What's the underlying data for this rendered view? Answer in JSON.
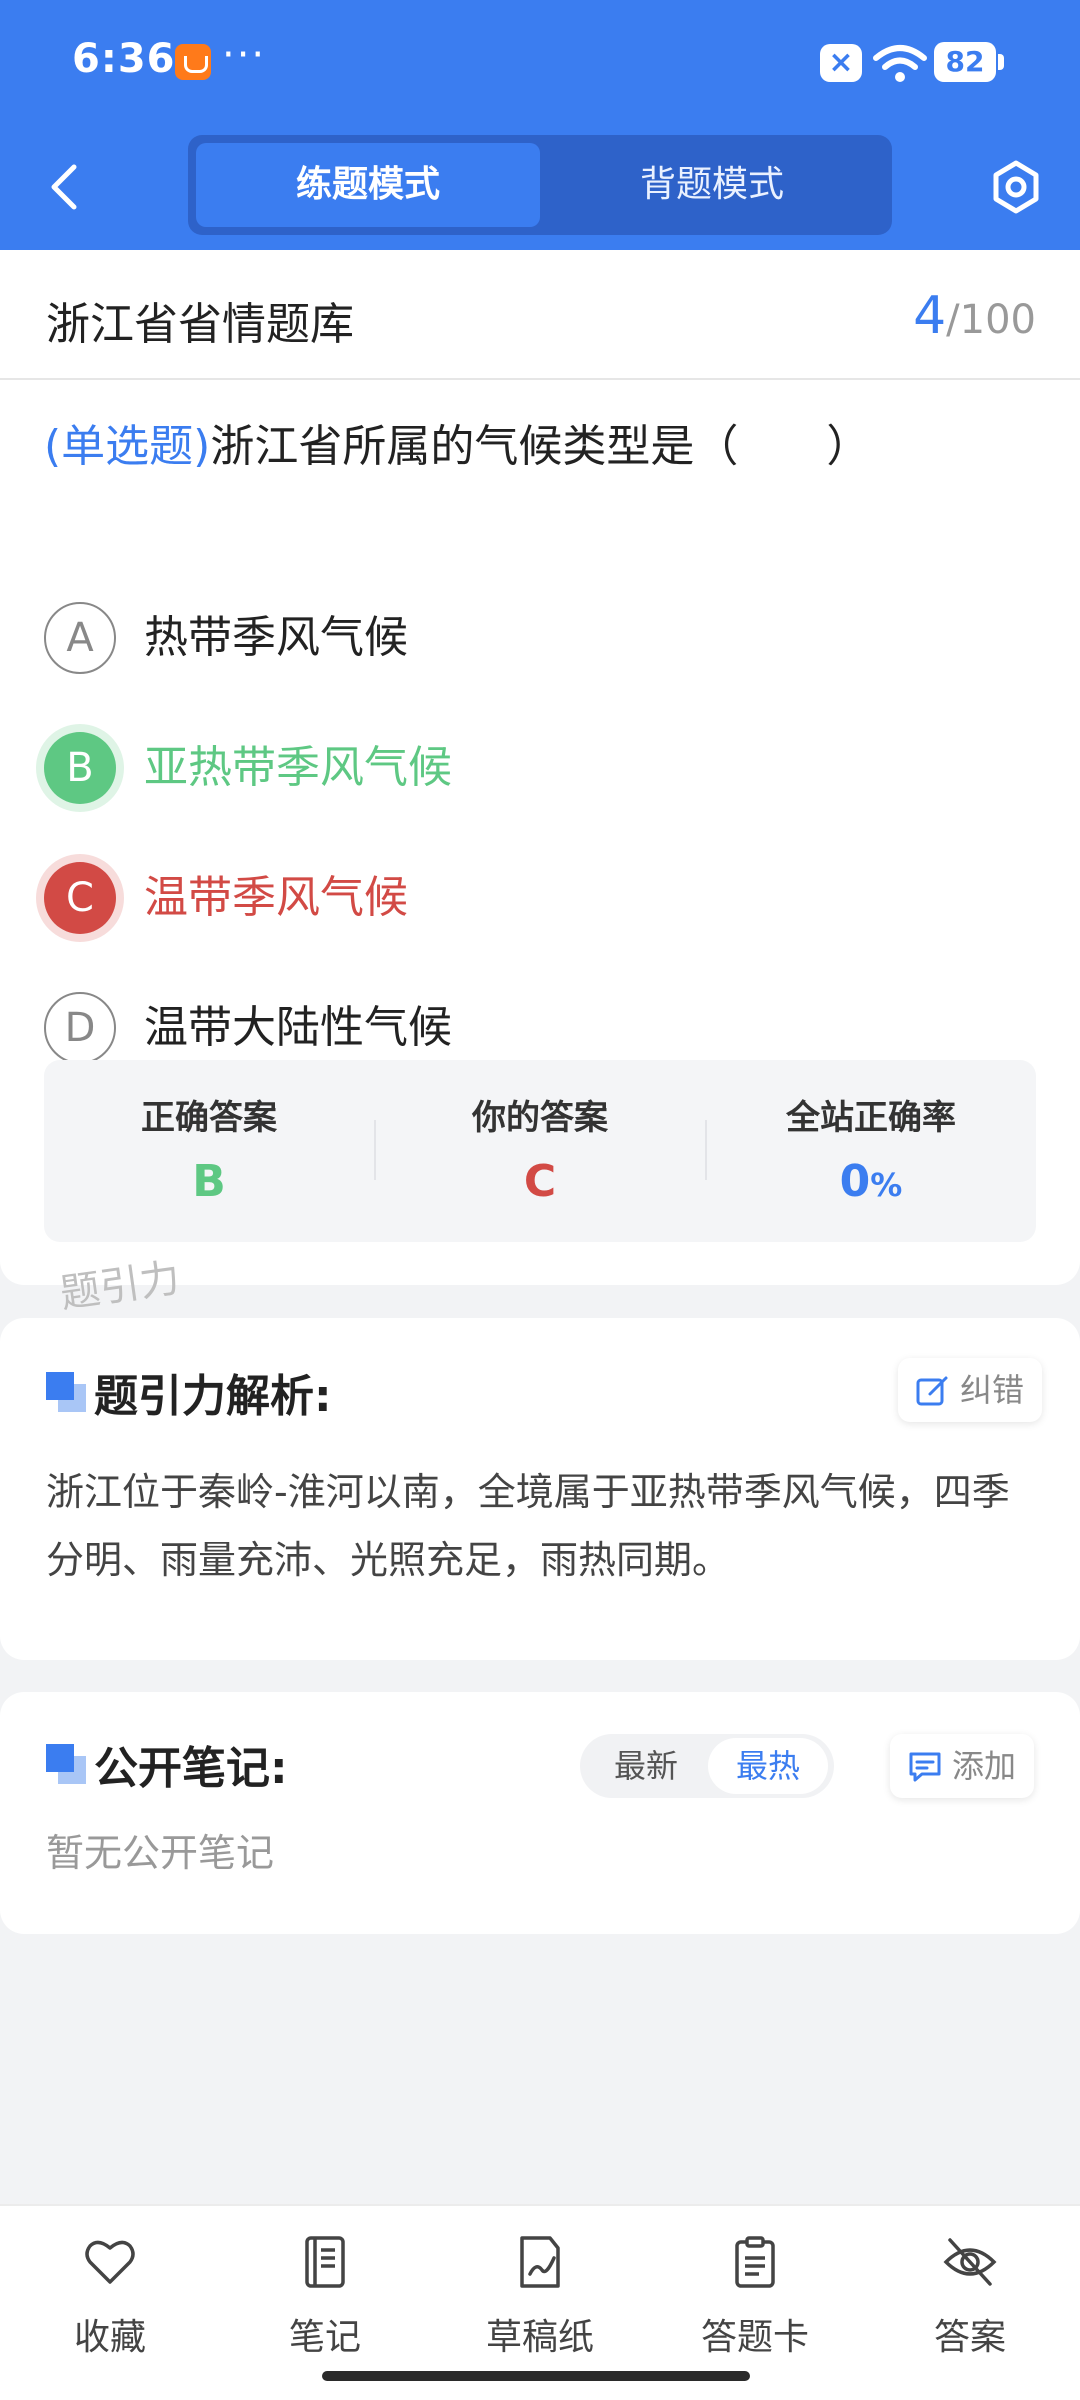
{
  "status_bar": {
    "time": "6:36",
    "dots": "···",
    "battery": "82"
  },
  "nav": {
    "modes": [
      "练题模式",
      "背题模式"
    ],
    "active_mode": "练题模式"
  },
  "question": {
    "bank_title": "浙江省省情题库",
    "progress_current": "4",
    "progress_total": "/100",
    "type_label": "(单选题)",
    "text": "浙江省所属的气候类型是（　　）",
    "options": [
      {
        "letter": "A",
        "text": "热带季风气候",
        "state": "normal"
      },
      {
        "letter": "B",
        "text": "亚热带季风气候",
        "state": "correct"
      },
      {
        "letter": "C",
        "text": "温带季风气候",
        "state": "wrong"
      },
      {
        "letter": "D",
        "text": "温带大陆性气候",
        "state": "normal"
      }
    ]
  },
  "stats": {
    "correct_label": "正确答案",
    "correct_value": "B",
    "yours_label": "你的答案",
    "yours_value": "C",
    "rate_label": "全站正确率",
    "rate_value": "0",
    "rate_unit": "%"
  },
  "watermark": "题引力",
  "analysis": {
    "title": "题引力解析:",
    "report_label": "纠错",
    "text": "浙江位于秦岭-淮河以南，全境属于亚热带季风气候，四季分明、雨量充沛、光照充足，雨热同期。"
  },
  "notes": {
    "title": "公开笔记:",
    "sort_newest": "最新",
    "sort_hottest": "最热",
    "add_label": "添加",
    "empty_text": "暂无公开笔记"
  },
  "toolbar": [
    {
      "label": "收藏",
      "icon": "heart-icon"
    },
    {
      "label": "笔记",
      "icon": "notebook-icon"
    },
    {
      "label": "草稿纸",
      "icon": "draft-paper-icon"
    },
    {
      "label": "答题卡",
      "icon": "answer-card-icon"
    },
    {
      "label": "答案",
      "icon": "eye-off-icon"
    }
  ],
  "colors": {
    "primary": "#3b7df0",
    "correct": "#5ec883",
    "wrong": "#d24a45"
  }
}
